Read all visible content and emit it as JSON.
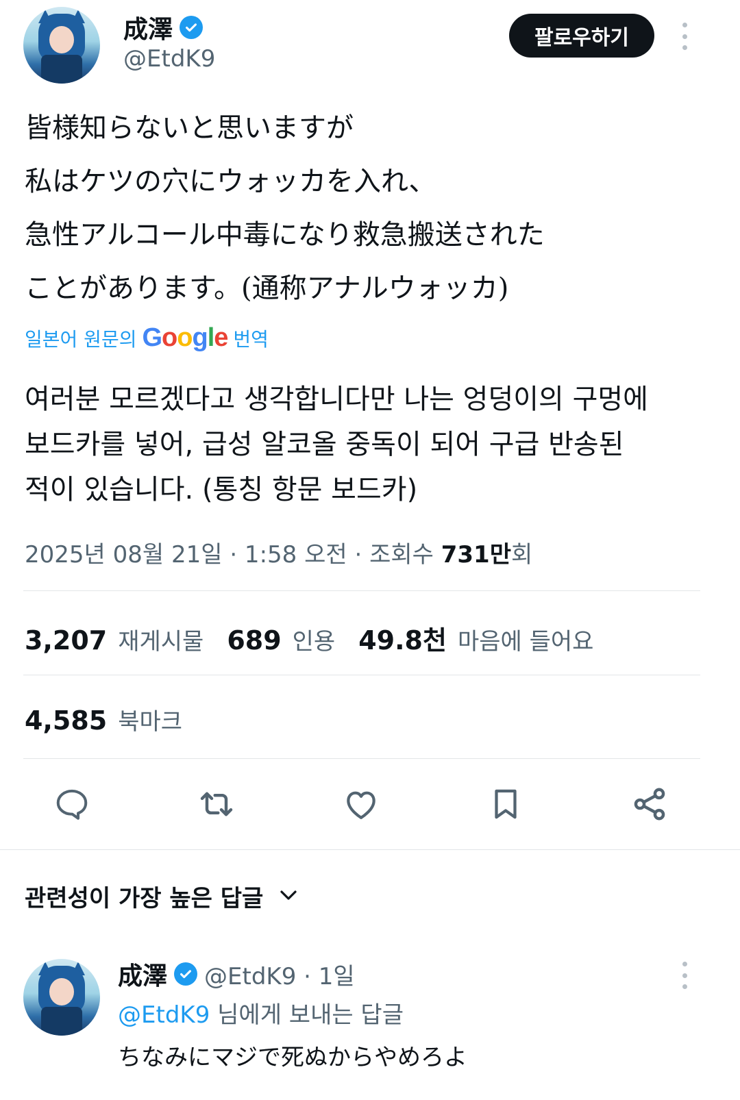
{
  "author": {
    "name": "成澤",
    "handle": "@EtdK9"
  },
  "follow_label": "팔로우하기",
  "tweet": {
    "lines_ja": [
      "皆様知らないと思いますが",
      "私はケツの穴にウォッカを入れ、",
      "急性アルコール中毒になり救急搬送された",
      "ことがあります。(通称アナルウォッカ)"
    ],
    "translate_prefix": "일본어 원문의",
    "translate_suffix": "번역",
    "lines_ko": [
      "여러분 모르겠다고 생각합니다만 나는 엉덩이의 구멍에",
      "보드카를 넣어, 급성 알코올 중독이 되어 구급 반송된",
      "적이 있습니다. (통칭 항문 보드카)"
    ]
  },
  "meta": {
    "datetime": "2025년 08월 21일 · 1:58 오전 · 조회수 ",
    "views": "731만",
    "views_suffix": "회"
  },
  "stats": {
    "reposts_count": "3,207",
    "reposts_label": "재게시물",
    "quotes_count": "689",
    "quotes_label": "인용",
    "likes_count": "49.8천",
    "likes_label": "마음에 들어요",
    "bookmarks_count": "4,585",
    "bookmarks_label": "북마크"
  },
  "icons": {
    "reply": "reply-icon",
    "repost": "repost-icon",
    "like": "heart-icon",
    "bookmark": "bookmark-icon",
    "share": "share-icon"
  },
  "replies": {
    "sort_label": "관련성이 가장 높은 답글",
    "items": [
      {
        "name": "成澤",
        "handle_time": "@EtdK9 · 1일",
        "reply_to_mention": "@EtdK9",
        "reply_to_suffix": " 님에게 보내는 답글",
        "text": "ちなみにマジで死ぬからやめろよ"
      }
    ]
  },
  "colors": {
    "accent": "#1d9bf0",
    "secondary_text": "#536471",
    "primary_text": "#0f1419",
    "divider": "#e3e6e8"
  }
}
